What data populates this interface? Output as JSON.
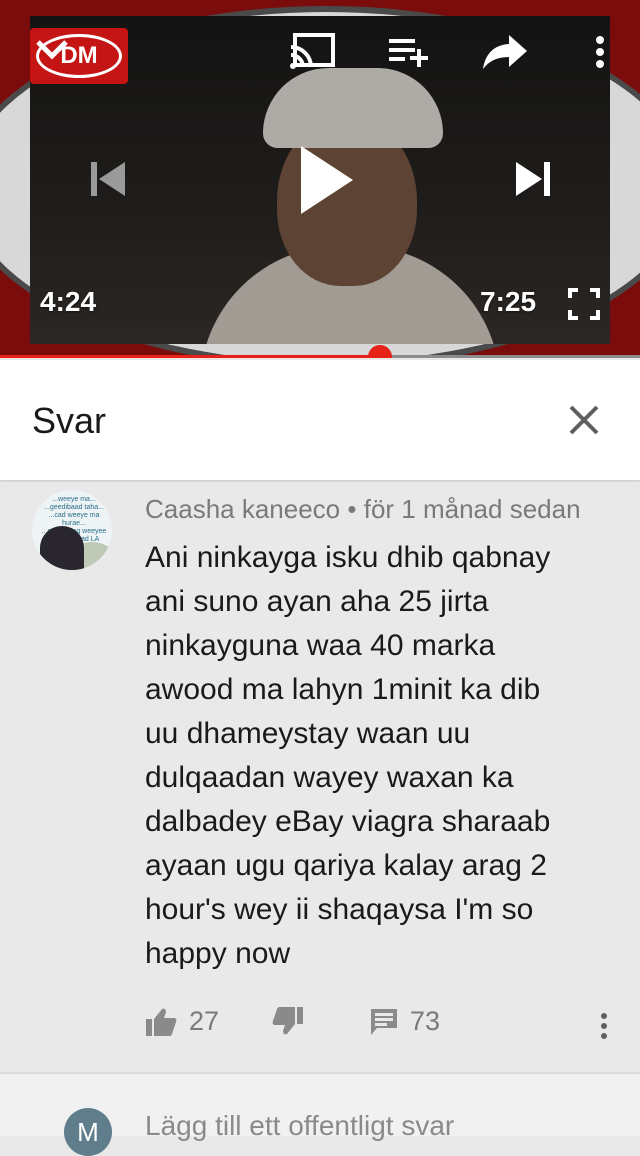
{
  "player": {
    "logo_text": "DM",
    "current_time": "4:24",
    "duration": "7:25",
    "progress_fraction": 0.593,
    "accent_color": "#e62117",
    "icons": [
      "chevron-down-icon",
      "cast-icon",
      "add-to-playlist-icon",
      "share-icon",
      "more-vert-icon",
      "skip-previous-icon",
      "play-icon",
      "skip-next-icon",
      "fullscreen-icon"
    ]
  },
  "replies": {
    "title": "Svar",
    "close_icon": "close-icon"
  },
  "comment": {
    "author": "Caasha kaneeco",
    "separator": "•",
    "time_ago": "för 1 månad sedan",
    "avatar_text": "...weeye ma...\n...geedibaad taha...\n...cad weeye ma hurae...\n...eeridu xaq weeyee\nGod maxaad LA galaysaa",
    "text": "Ani ninkayga isku dhib qabnay\nani suno ayan aha 25 jirta\nninkayguna waa 40  marka\nawood ma lahyn 1minit ka dib\nuu dhameystay waan uu\ndulqaadan wayey waxan ka\ndalbadey eBay viagra sharaab\nayaan ugu qariya kalay arag 2\nhour's wey ii shaqaysa I'm so\nhappy now",
    "likes": "27",
    "replies_count": "73"
  },
  "composer": {
    "avatar_letter": "M",
    "placeholder": "Lägg till ett offentligt svar"
  }
}
